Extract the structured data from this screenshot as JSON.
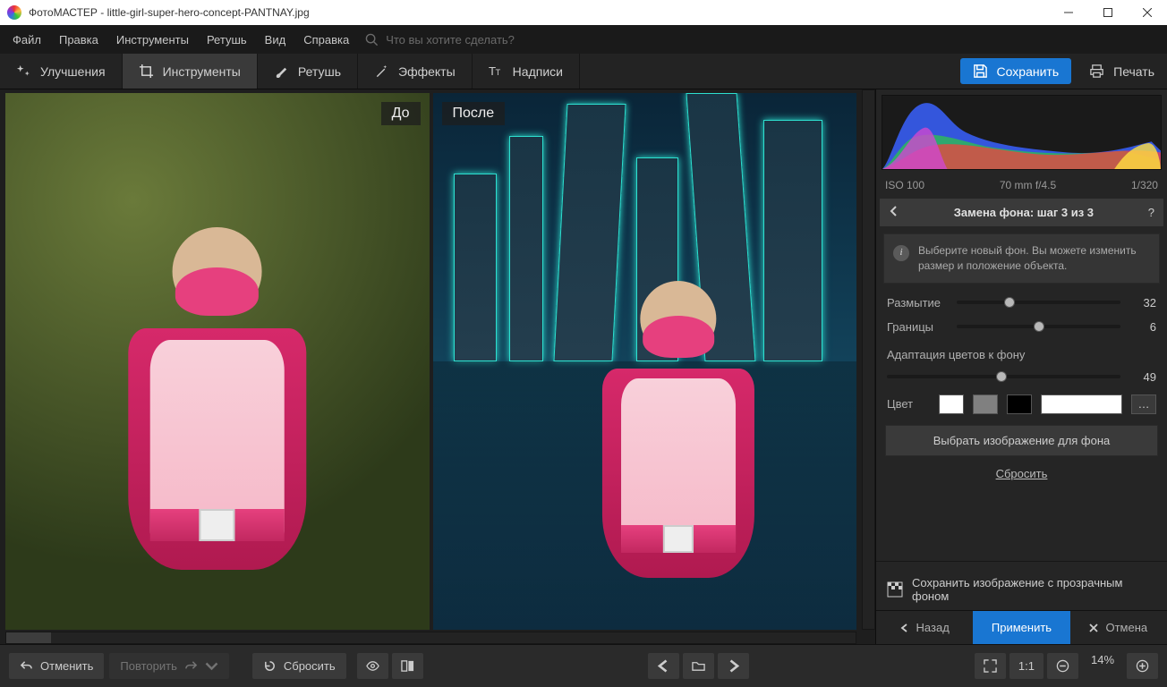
{
  "app": {
    "title": "ФотоМАСТЕР - little-girl-super-hero-concept-PANTNAY.jpg"
  },
  "menu": {
    "items": [
      "Файл",
      "Правка",
      "Инструменты",
      "Ретушь",
      "Вид",
      "Справка"
    ],
    "search_placeholder": "Что вы хотите сделать?"
  },
  "toolbar": {
    "enhance": "Улучшения",
    "tools": "Инструменты",
    "retouch": "Ретушь",
    "effects": "Эффекты",
    "text": "Надписи",
    "save": "Сохранить",
    "print": "Печать"
  },
  "canvas": {
    "before": "До",
    "after": "После"
  },
  "exif": {
    "iso": "ISO 100",
    "lens": "70 mm f/4.5",
    "shutter": "1/320"
  },
  "panel": {
    "title": "Замена фона: шаг 3 из 3",
    "info": "Выберите новый фон. Вы можете изменить размер и положение объекта.",
    "blur": {
      "label": "Размытие",
      "value": 32,
      "pct": 32
    },
    "edges": {
      "label": "Границы",
      "value": 6,
      "pct": 50
    },
    "adapt_label": "Адаптация цветов к фону",
    "adapt": {
      "value": 49,
      "pct": 49
    },
    "color_label": "Цвет",
    "choose_bg": "Выбрать изображение для фона",
    "reset": "Сбросить",
    "save_transparent": "Сохранить изображение с прозрачным фоном",
    "back": "Назад",
    "apply": "Применить",
    "cancel": "Отмена",
    "colors": {
      "white": "#ffffff",
      "gray": "#808080",
      "black": "#000000",
      "current": "#ffffff"
    }
  },
  "bottom": {
    "undo": "Отменить",
    "redo": "Повторить",
    "reset": "Сбросить",
    "zoom_mode": "1:1",
    "zoom_pct": "14%"
  }
}
